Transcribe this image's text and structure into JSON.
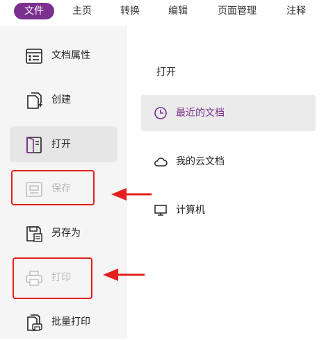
{
  "menubar": {
    "tabs": [
      {
        "label": "文件",
        "active": true
      },
      {
        "label": "主页"
      },
      {
        "label": "转换"
      },
      {
        "label": "编辑"
      },
      {
        "label": "页面管理"
      },
      {
        "label": "注释"
      }
    ]
  },
  "sidebar": {
    "items": [
      {
        "label": "文档属性",
        "icon": "document-properties-icon"
      },
      {
        "label": "创建",
        "icon": "create-document-icon"
      },
      {
        "label": "打开",
        "icon": "open-book-icon",
        "selected": true
      },
      {
        "label": "保存",
        "icon": "save-icon",
        "disabled": true
      },
      {
        "label": "另存为",
        "icon": "save-as-icon"
      },
      {
        "label": "打印",
        "icon": "printer-icon",
        "disabled": true
      },
      {
        "label": "批量打印",
        "icon": "batch-print-icon"
      }
    ]
  },
  "open_panel": {
    "title": "打开",
    "places": [
      {
        "label": "最近的文档",
        "icon": "clock-icon",
        "selected": true
      },
      {
        "label": "我的云文档",
        "icon": "cloud-icon"
      },
      {
        "label": "计算机",
        "icon": "computer-icon"
      }
    ]
  },
  "colors": {
    "accent": "#7b2f8e",
    "annotation_red": "#e3201b",
    "sidebar_bg": "#f5f5f5",
    "selected_bg": "#e6e6e6"
  }
}
